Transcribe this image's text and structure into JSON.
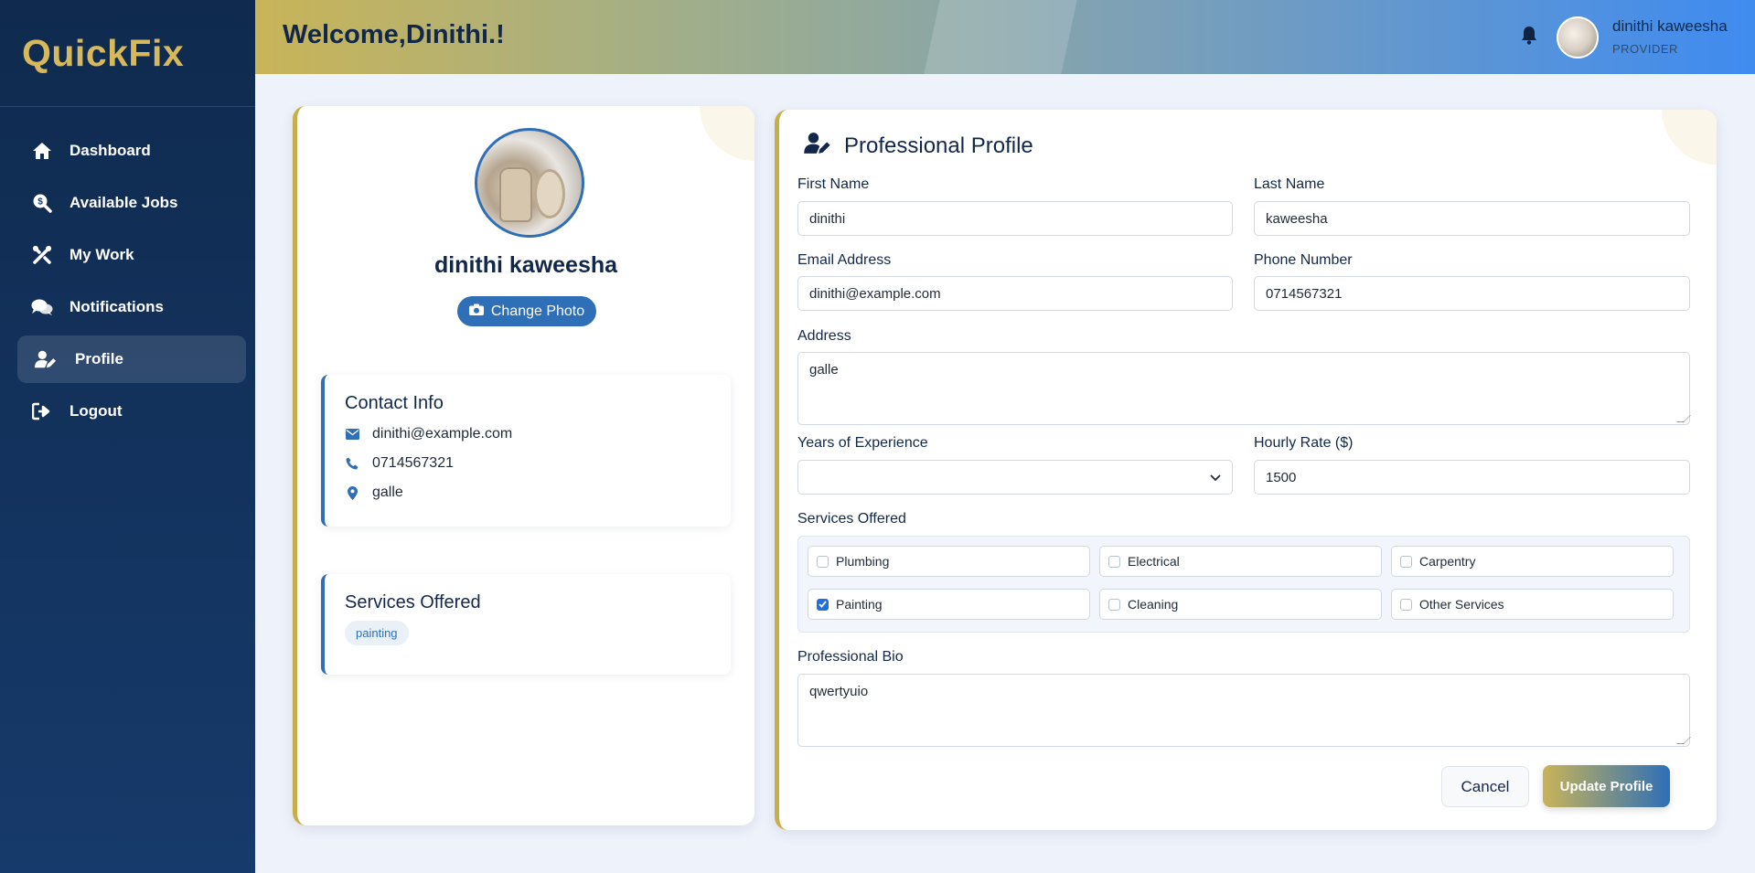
{
  "brand": "QuickFix",
  "nav": [
    {
      "label": "Dashboard",
      "icon": "home-icon"
    },
    {
      "label": "Available Jobs",
      "icon": "search-dollar-icon"
    },
    {
      "label": "My Work",
      "icon": "tools-icon"
    },
    {
      "label": "Notifications",
      "icon": "comments-icon"
    },
    {
      "label": "Profile",
      "icon": "user-edit-icon",
      "active": true
    },
    {
      "label": "Logout",
      "icon": "sign-out-icon"
    }
  ],
  "header": {
    "welcome": "Welcome,Dinithi.!",
    "user_name": "dinithi kaweesha",
    "user_role": "PROVIDER"
  },
  "profile_card": {
    "name": "dinithi kaweesha",
    "change_photo": "Change Photo",
    "contact_title": "Contact Info",
    "email": "dinithi@example.com",
    "phone": "0714567321",
    "address": "galle",
    "services_title": "Services Offered",
    "services": [
      "painting"
    ]
  },
  "form": {
    "title": "Professional Profile",
    "first_name_label": "First Name",
    "first_name": "dinithi",
    "last_name_label": "Last Name",
    "last_name": "kaweesha",
    "email_label": "Email Address",
    "email": "dinithi@example.com",
    "phone_label": "Phone Number",
    "phone": "0714567321",
    "address_label": "Address",
    "address": "galle",
    "experience_label": "Years of Experience",
    "experience": "",
    "rate_label": "Hourly Rate ($)",
    "rate": "1500",
    "services_label": "Services Offered",
    "services": [
      {
        "label": "Plumbing",
        "checked": false
      },
      {
        "label": "Electrical",
        "checked": false
      },
      {
        "label": "Carpentry",
        "checked": false
      },
      {
        "label": "Painting",
        "checked": true
      },
      {
        "label": "Cleaning",
        "checked": false
      },
      {
        "label": "Other Services",
        "checked": false
      }
    ],
    "bio_label": "Professional Bio",
    "bio": "qwertyuio",
    "cancel": "Cancel",
    "update": "Update Profile"
  },
  "colors": {
    "sidebar": "#0f2a4e",
    "brand_gold": "#d7b95b",
    "accent_blue": "#2e6fb7",
    "card_border_gold": "#c9ad4a"
  }
}
